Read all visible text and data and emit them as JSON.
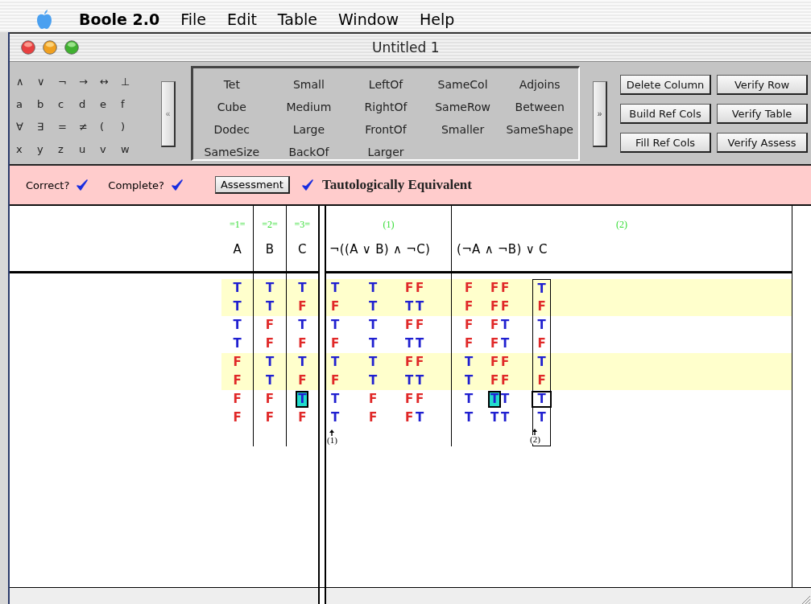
{
  "menu_bar": {
    "app": "Boole 2.0",
    "items": [
      "File",
      "Edit",
      "Table",
      "Window",
      "Help"
    ]
  },
  "window": {
    "title": "Untitled 1"
  },
  "toolbar": {
    "symbols": [
      "∧",
      "∨",
      "¬",
      "→",
      "↔",
      "⊥",
      "a",
      "b",
      "c",
      "d",
      "e",
      "f",
      "∀",
      "∃",
      "=",
      "≠",
      "(",
      ")",
      "x",
      "y",
      "z",
      "u",
      "v",
      "w"
    ],
    "collapse_button": "«",
    "predicates": [
      "Tet",
      "Small",
      "LeftOf",
      "SameCol",
      "Adjoins",
      "Cube",
      "Medium",
      "RightOf",
      "SameRow",
      "Between",
      "Dodec",
      "Large",
      "FrontOf",
      "Smaller",
      "SameShape",
      "SameSize",
      "BackOf",
      "Larger"
    ],
    "expand_button": "»",
    "buttons": [
      "Delete Column",
      "Verify Row",
      "Build Ref Cols",
      "Verify Table",
      "Fill Ref Cols",
      "Verify Assess"
    ]
  },
  "status": {
    "checks": [
      {
        "label": "Correct?",
        "checked": true
      },
      {
        "label": "Complete?",
        "checked": true
      }
    ],
    "assessment_button": "Assessment",
    "assessment_checked": true,
    "result": "Tautologically Equivalent"
  },
  "table": {
    "reference_columns": [
      {
        "ref": "=1=",
        "label": "A"
      },
      {
        "ref": "=2=",
        "label": "B"
      },
      {
        "ref": "=3=",
        "label": "C"
      }
    ],
    "sentences": [
      {
        "ref": "(1)",
        "formula": "¬((A ∨ B) ∧ ¬C)",
        "columns": [
          {
            "boxed": false,
            "marker": "(1)"
          },
          {
            "boxed": false
          },
          {
            "boxed": false
          },
          {
            "boxed": false
          }
        ]
      },
      {
        "ref": "(2)",
        "formula": "(¬A ∧ ¬B) ∨ C",
        "columns": [
          {
            "boxed": false
          },
          {
            "boxed": false
          },
          {
            "boxed": false
          },
          {
            "boxed": true,
            "marker": "(2)"
          }
        ]
      }
    ],
    "rows": [
      {
        "highlighted": true,
        "current": false,
        "reference_cells": [
          {
            "text": "T",
            "value": true,
            "selected": false
          },
          {
            "text": "T",
            "value": true,
            "selected": false
          },
          {
            "text": "T",
            "value": true,
            "selected": false
          }
        ],
        "sentence_cells": [
          [
            {
              "text": "T",
              "value": true,
              "selected": false
            },
            {
              "text": "T",
              "value": true,
              "selected": false
            },
            {
              "text": "F",
              "value": false,
              "selected": false
            },
            {
              "text": "F",
              "value": false,
              "selected": false
            }
          ],
          [
            {
              "text": "F",
              "value": false,
              "selected": false
            },
            {
              "text": "F",
              "value": false,
              "selected": false
            },
            {
              "text": "F",
              "value": false,
              "selected": false
            },
            {
              "text": "T",
              "value": true,
              "selected": false
            }
          ]
        ]
      },
      {
        "highlighted": true,
        "current": false,
        "reference_cells": [
          {
            "text": "T",
            "value": true,
            "selected": false
          },
          {
            "text": "T",
            "value": true,
            "selected": false
          },
          {
            "text": "F",
            "value": false,
            "selected": false
          }
        ],
        "sentence_cells": [
          [
            {
              "text": "F",
              "value": false,
              "selected": false
            },
            {
              "text": "T",
              "value": true,
              "selected": false
            },
            {
              "text": "T",
              "value": true,
              "selected": false
            },
            {
              "text": "T",
              "value": true,
              "selected": false
            }
          ],
          [
            {
              "text": "F",
              "value": false,
              "selected": false
            },
            {
              "text": "F",
              "value": false,
              "selected": false
            },
            {
              "text": "F",
              "value": false,
              "selected": false
            },
            {
              "text": "F",
              "value": false,
              "selected": false
            }
          ]
        ]
      },
      {
        "highlighted": false,
        "current": false,
        "reference_cells": [
          {
            "text": "T",
            "value": true,
            "selected": false
          },
          {
            "text": "F",
            "value": false,
            "selected": false
          },
          {
            "text": "T",
            "value": true,
            "selected": false
          }
        ],
        "sentence_cells": [
          [
            {
              "text": "T",
              "value": true,
              "selected": false
            },
            {
              "text": "T",
              "value": true,
              "selected": false
            },
            {
              "text": "F",
              "value": false,
              "selected": false
            },
            {
              "text": "F",
              "value": false,
              "selected": false
            }
          ],
          [
            {
              "text": "F",
              "value": false,
              "selected": false
            },
            {
              "text": "F",
              "value": false,
              "selected": false
            },
            {
              "text": "T",
              "value": true,
              "selected": false
            },
            {
              "text": "T",
              "value": true,
              "selected": false
            }
          ]
        ]
      },
      {
        "highlighted": false,
        "current": false,
        "reference_cells": [
          {
            "text": "T",
            "value": true,
            "selected": false
          },
          {
            "text": "F",
            "value": false,
            "selected": false
          },
          {
            "text": "F",
            "value": false,
            "selected": false
          }
        ],
        "sentence_cells": [
          [
            {
              "text": "F",
              "value": false,
              "selected": false
            },
            {
              "text": "T",
              "value": true,
              "selected": false
            },
            {
              "text": "T",
              "value": true,
              "selected": false
            },
            {
              "text": "T",
              "value": true,
              "selected": false
            }
          ],
          [
            {
              "text": "F",
              "value": false,
              "selected": false
            },
            {
              "text": "F",
              "value": false,
              "selected": false
            },
            {
              "text": "T",
              "value": true,
              "selected": false
            },
            {
              "text": "F",
              "value": false,
              "selected": false
            }
          ]
        ]
      },
      {
        "highlighted": true,
        "current": false,
        "reference_cells": [
          {
            "text": "F",
            "value": false,
            "selected": false
          },
          {
            "text": "T",
            "value": true,
            "selected": false
          },
          {
            "text": "T",
            "value": true,
            "selected": false
          }
        ],
        "sentence_cells": [
          [
            {
              "text": "T",
              "value": true,
              "selected": false
            },
            {
              "text": "T",
              "value": true,
              "selected": false
            },
            {
              "text": "F",
              "value": false,
              "selected": false
            },
            {
              "text": "F",
              "value": false,
              "selected": false
            }
          ],
          [
            {
              "text": "T",
              "value": true,
              "selected": false
            },
            {
              "text": "F",
              "value": false,
              "selected": false
            },
            {
              "text": "F",
              "value": false,
              "selected": false
            },
            {
              "text": "T",
              "value": true,
              "selected": false
            }
          ]
        ]
      },
      {
        "highlighted": true,
        "current": false,
        "reference_cells": [
          {
            "text": "F",
            "value": false,
            "selected": false
          },
          {
            "text": "T",
            "value": true,
            "selected": false
          },
          {
            "text": "F",
            "value": false,
            "selected": false
          }
        ],
        "sentence_cells": [
          [
            {
              "text": "F",
              "value": false,
              "selected": false
            },
            {
              "text": "T",
              "value": true,
              "selected": false
            },
            {
              "text": "T",
              "value": true,
              "selected": false
            },
            {
              "text": "T",
              "value": true,
              "selected": false
            }
          ],
          [
            {
              "text": "T",
              "value": true,
              "selected": false
            },
            {
              "text": "F",
              "value": false,
              "selected": false
            },
            {
              "text": "F",
              "value": false,
              "selected": false
            },
            {
              "text": "F",
              "value": false,
              "selected": false
            }
          ]
        ]
      },
      {
        "highlighted": false,
        "current": true,
        "reference_cells": [
          {
            "text": "F",
            "value": false,
            "selected": false
          },
          {
            "text": "F",
            "value": false,
            "selected": false
          },
          {
            "text": "T",
            "value": true,
            "selected": true
          }
        ],
        "sentence_cells": [
          [
            {
              "text": "T",
              "value": true,
              "selected": false
            },
            {
              "text": "F",
              "value": false,
              "selected": false
            },
            {
              "text": "F",
              "value": false,
              "selected": false
            },
            {
              "text": "F",
              "value": false,
              "selected": false
            }
          ],
          [
            {
              "text": "T",
              "value": true,
              "selected": false
            },
            {
              "text": "T",
              "value": true,
              "selected": true
            },
            {
              "text": "T",
              "value": true,
              "selected": false
            },
            {
              "text": "T",
              "value": true,
              "selected": false
            }
          ]
        ]
      },
      {
        "highlighted": false,
        "current": false,
        "reference_cells": [
          {
            "text": "F",
            "value": false,
            "selected": false
          },
          {
            "text": "F",
            "value": false,
            "selected": false
          },
          {
            "text": "F",
            "value": false,
            "selected": false
          }
        ],
        "sentence_cells": [
          [
            {
              "text": "T",
              "value": true,
              "selected": false
            },
            {
              "text": "F",
              "value": false,
              "selected": false
            },
            {
              "text": "F",
              "value": false,
              "selected": false
            },
            {
              "text": "T",
              "value": true,
              "selected": false
            }
          ],
          [
            {
              "text": "T",
              "value": true,
              "selected": false
            },
            {
              "text": "T",
              "value": true,
              "selected": false
            },
            {
              "text": "T",
              "value": true,
              "selected": false
            },
            {
              "text": "T",
              "value": true,
              "selected": false
            }
          ]
        ]
      }
    ]
  }
}
